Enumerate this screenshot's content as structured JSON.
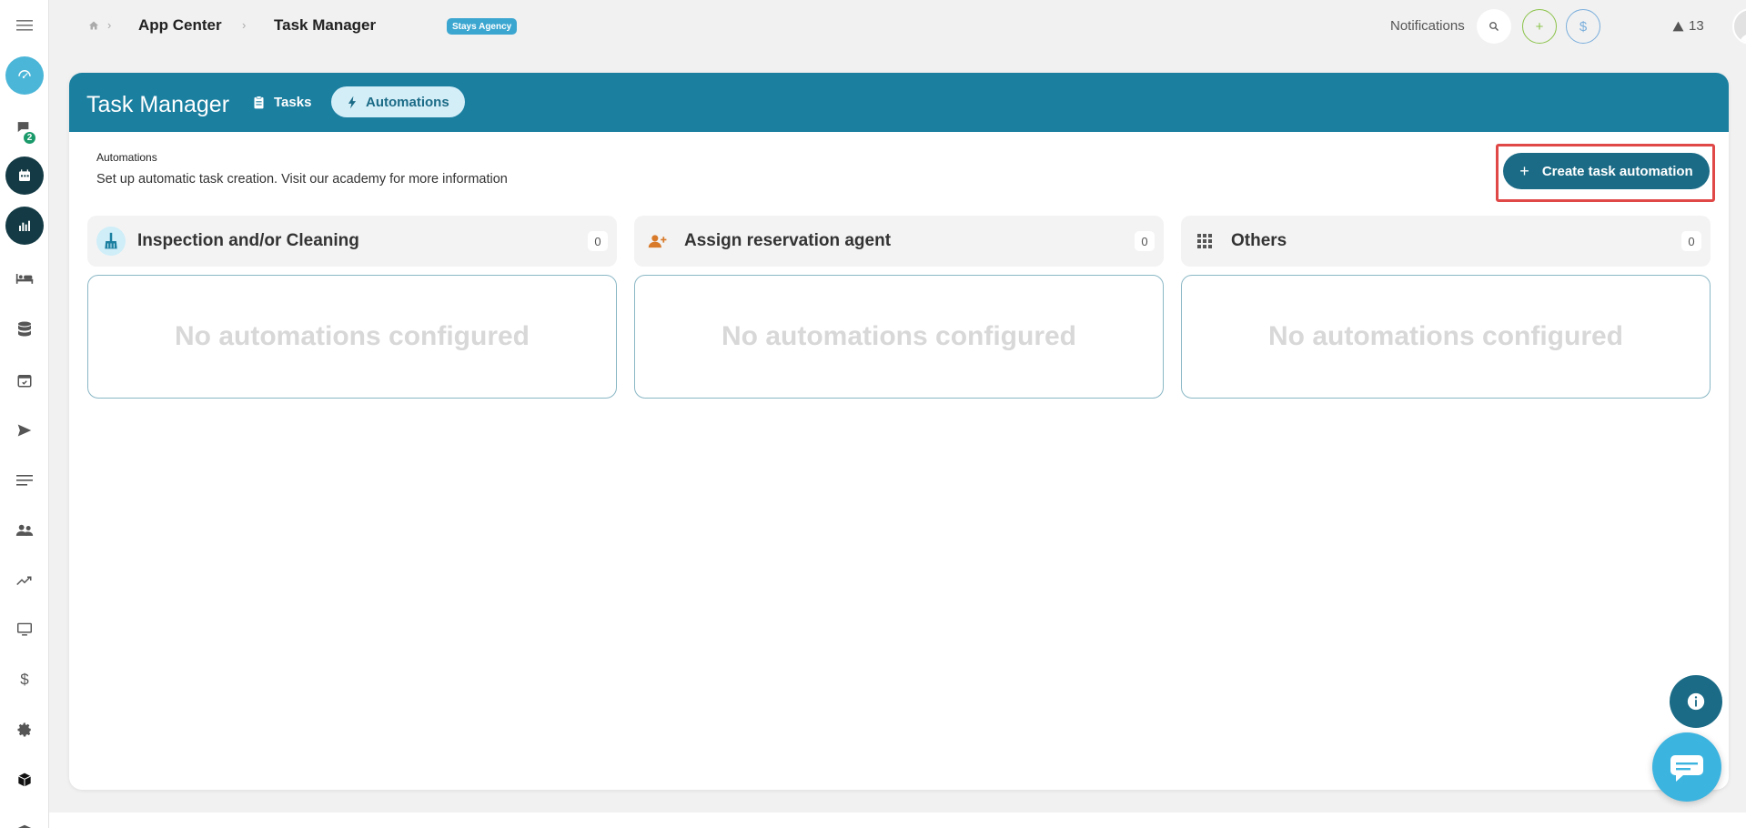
{
  "sidebar": {
    "nav_badge": "2"
  },
  "breadcrumb": {
    "items": [
      "App Center",
      "Task Manager"
    ],
    "tag": "Stays Agency"
  },
  "topbar": {
    "notifications_label": "Notifications",
    "plus_label": "+",
    "dollar_label": "$",
    "alert_count": "13"
  },
  "page": {
    "title": "Task Manager",
    "tabs": [
      {
        "label": "Tasks",
        "icon": "clipboard-icon",
        "active": false
      },
      {
        "label": "Automations",
        "icon": "bolt-icon",
        "active": true
      }
    ],
    "section_label": "Automations",
    "section_description": "Set up automatic task creation. Visit our academy for more information",
    "create_button_label": "Create task automation"
  },
  "columns": [
    {
      "title": "Inspection and/or Cleaning",
      "count": "0",
      "icon": "broom-icon",
      "empty_text": "No automations configured"
    },
    {
      "title": "Assign reservation agent",
      "count": "0",
      "icon": "add-person-icon",
      "empty_text": "No automations configured"
    },
    {
      "title": "Others",
      "count": "0",
      "icon": "grid-icon",
      "empty_text": "No automations configured"
    }
  ],
  "colors": {
    "header_bg": "#1b7fa0",
    "button_bg": "#1b6b86",
    "tab_active_bg": "#d4eef8",
    "highlight_border": "#e04848",
    "badge_green": "#1a9a6b"
  }
}
